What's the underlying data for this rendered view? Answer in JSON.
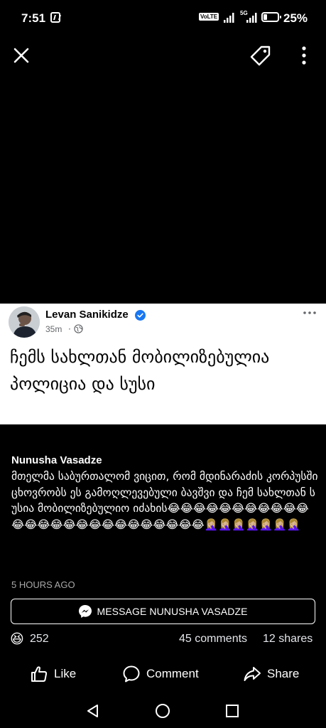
{
  "status_bar": {
    "time": "7:51",
    "volte": "VoLTE",
    "net_type": "5G",
    "battery": "25%"
  },
  "top_bar": {
    "close_icon": "close-icon",
    "tag_icon": "tag-icon",
    "more_icon": "more-vertical-icon"
  },
  "post": {
    "author": "Levan Sanikidze",
    "time": "35m",
    "dot": "·",
    "audience_icon": "globe-icon",
    "text": "ჩემს სახლთან მობილიზებულია პოლიცია და სუსი"
  },
  "comment": {
    "author": "Nunusha Vasadze",
    "text": "მთელმა საბურთალომ ვიცით, რომ მდინარაძის კორპუსში ცხოვრობს ეს გამოღლევებული ბავშვი და ჩემ სახლთან სუსია მობილიზებულიო იძახის😂😂😂😂😂😂😂😂😂😂😂😂😂😂😂😂😂😂😂😂😂😂😂😂😂😂🤦🏼‍♀️🤦🏼‍♀️🤦🏼‍♀️🤦🏼‍♀️🤦🏼‍♀️🤦🏼‍♀️🤦🏼‍♀️",
    "time": "5 HOURS AGO",
    "message_button": "MESSAGE NUNUSHA VASADZE"
  },
  "stats": {
    "reaction_emoji": "😆",
    "reaction_count": "252",
    "comments": "45 comments",
    "shares": "12 shares"
  },
  "actions": {
    "like": "Like",
    "comment": "Comment",
    "share": "Share"
  },
  "colors": {
    "background": "#000000",
    "card": "#ffffff",
    "verified": "#1877f2",
    "muted": "#a8a8a8"
  }
}
